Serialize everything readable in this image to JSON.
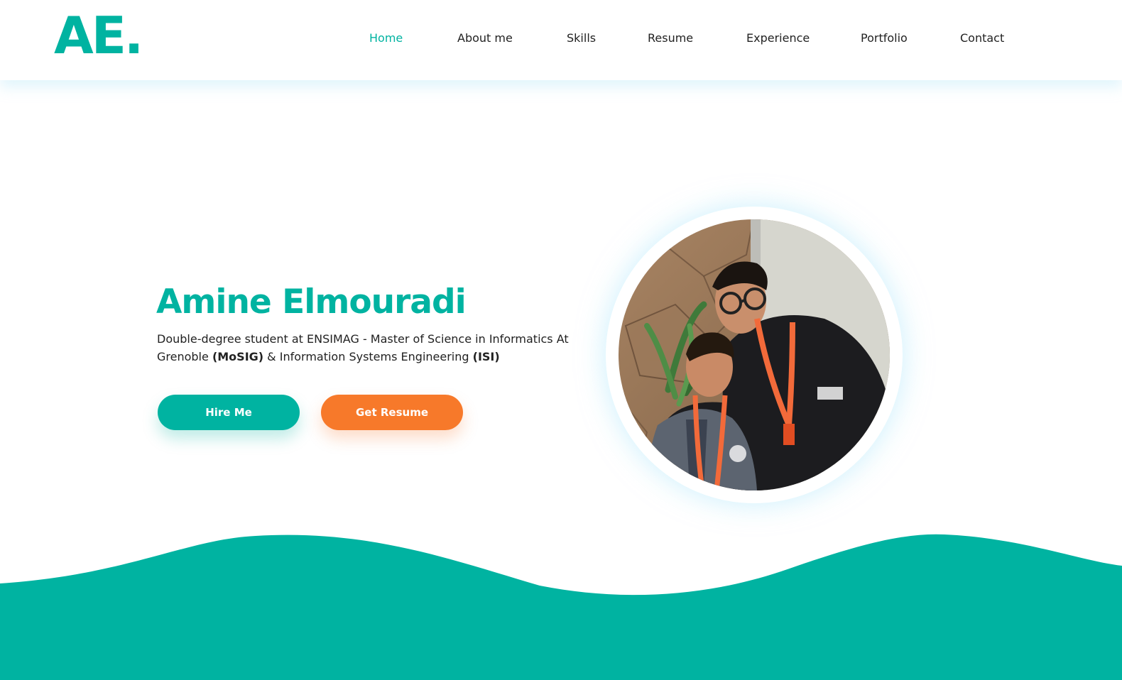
{
  "header": {
    "logo": "AE.",
    "nav": [
      {
        "label": "Home",
        "active": true
      },
      {
        "label": "About me"
      },
      {
        "label": "Skills"
      },
      {
        "label": "Resume"
      },
      {
        "label": "Experience"
      },
      {
        "label": "Portfolio"
      },
      {
        "label": "Contact"
      }
    ]
  },
  "hero": {
    "name": "Amine Elmouradi",
    "description": {
      "part1": "Double-degree student at ENSIMAG - Master of Science in Informatics At Grenoble ",
      "bold1": "(MoSIG)",
      "part2": " & Information Systems Engineering ",
      "bold2": "(ISI)"
    },
    "buttons": {
      "hire": "Hire Me",
      "resume": "Get Resume"
    },
    "photo_icon": "profile-photo"
  },
  "colors": {
    "accent": "#00b3a1",
    "secondary": "#f7792a",
    "text": "#222222"
  }
}
